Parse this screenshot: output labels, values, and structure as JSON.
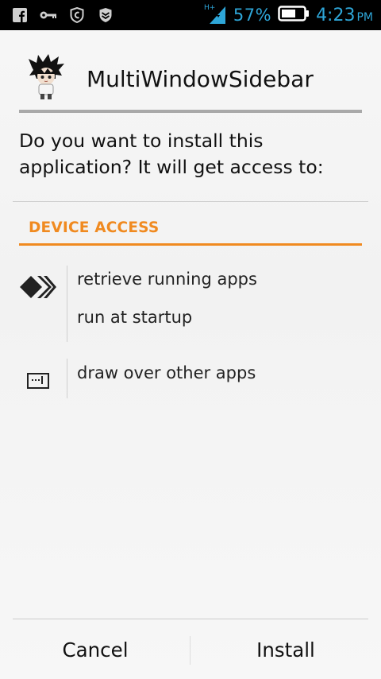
{
  "status_bar": {
    "battery_percent": "57%",
    "time": "4:23",
    "ampm": "PM",
    "network": "H+",
    "icons": [
      "facebook-icon",
      "key-icon",
      "shield-icon",
      "shield-chevron-icon",
      "signal-icon",
      "battery-icon"
    ],
    "accent_color": "#2ea6d8"
  },
  "app": {
    "name": "MultiWindowSidebar",
    "icon": "anime-character-icon"
  },
  "dialog": {
    "question": "Do you want to install this application? It will get access to:",
    "section_title": "DEVICE ACCESS",
    "section_color": "#f08a20",
    "permission_groups": [
      {
        "icon": "double-chevron-icon",
        "items": [
          "retrieve running apps",
          "run at startup"
        ]
      },
      {
        "icon": "window-overlay-icon",
        "items": [
          "draw over other apps"
        ]
      }
    ]
  },
  "buttons": {
    "cancel": "Cancel",
    "install": "Install"
  }
}
